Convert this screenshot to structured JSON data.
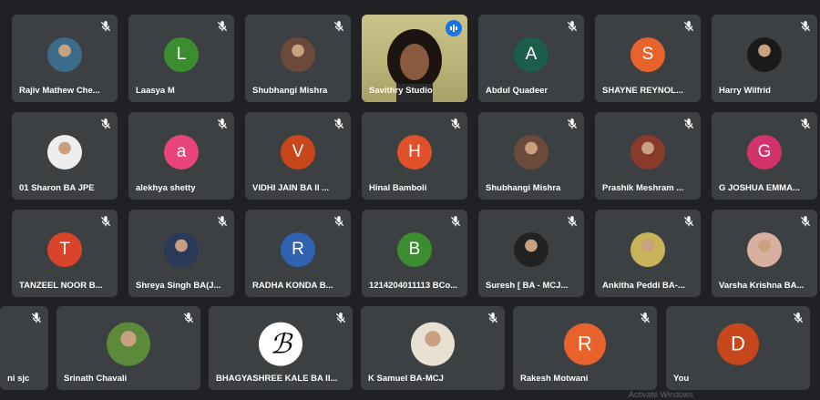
{
  "participants": {
    "row1": [
      {
        "name": "Rajiv Mathew Che...",
        "kind": "photo",
        "color": "#3d6b8a"
      },
      {
        "name": "Laasya M",
        "kind": "letter",
        "letter": "L",
        "color": "#3c8d2f"
      },
      {
        "name": "Shubhangi Mishra",
        "kind": "photo",
        "color": "#6b4a3a"
      },
      {
        "name": "Savithry Studio",
        "kind": "video",
        "color": "#b9b277"
      },
      {
        "name": "Abdul Quadeer",
        "kind": "letter",
        "letter": "A",
        "color": "#1b5e4b"
      },
      {
        "name": "SHAYNE REYNOL...",
        "kind": "letter",
        "letter": "S",
        "color": "#e8622c"
      },
      {
        "name": "Harry Wilfrid",
        "kind": "photo",
        "color": "#1a1a1a"
      }
    ],
    "row2": [
      {
        "name": "01 Sharon BA JPE",
        "kind": "photo",
        "color": "#eeeeee"
      },
      {
        "name": "alekhya shetty",
        "kind": "letter",
        "letter": "a",
        "color": "#e8457a"
      },
      {
        "name": "VIDHI JAIN BA II ...",
        "kind": "letter",
        "letter": "V",
        "color": "#c8461c"
      },
      {
        "name": "Hinal Bamboli",
        "kind": "letter",
        "letter": "H",
        "color": "#e0502a"
      },
      {
        "name": "Shubhangi Mishra",
        "kind": "photo",
        "color": "#6b4a3a"
      },
      {
        "name": "Prashik Meshram ...",
        "kind": "photo",
        "color": "#8a3a2a"
      },
      {
        "name": "G JOSHUA EMMA...",
        "kind": "letter",
        "letter": "G",
        "color": "#d3336b"
      }
    ],
    "row3": [
      {
        "name": "TANZEEL NOOR B...",
        "kind": "letter",
        "letter": "T",
        "color": "#d8442a"
      },
      {
        "name": "Shreya Singh BA(J...",
        "kind": "photo",
        "color": "#2a3a5a"
      },
      {
        "name": "RADHA KONDA B...",
        "kind": "letter",
        "letter": "R",
        "color": "#2f62b0"
      },
      {
        "name": "1214204011113 BCo...",
        "kind": "letter",
        "letter": "B",
        "color": "#3c8d2f"
      },
      {
        "name": "Suresh [ BA - MCJ...",
        "kind": "photo",
        "color": "#222222"
      },
      {
        "name": "Ankitha Peddi BA-...",
        "kind": "photo",
        "color": "#c8b25a"
      },
      {
        "name": "Varsha Krishna BA...",
        "kind": "photo",
        "color": "#d8b0a0"
      }
    ],
    "row4": [
      {
        "name": "ni sjc",
        "kind": "none",
        "color": "#3c4043"
      },
      {
        "name": "Srinath Chavali",
        "kind": "photo",
        "color": "#5a8a3a"
      },
      {
        "name": "BHAGYASHREE KALE BA II...",
        "kind": "logo",
        "color": "#ffffff"
      },
      {
        "name": "K Samuel BA-MCJ",
        "kind": "photo",
        "color": "#e8e0d0"
      },
      {
        "name": "Rakesh Motwani",
        "kind": "letter",
        "letter": "R",
        "color": "#e8622c"
      },
      {
        "name": "You",
        "kind": "letter",
        "letter": "D",
        "color": "#c8461c"
      }
    ]
  },
  "footer": {
    "watermark": "Activate Windows"
  },
  "colors": {
    "tile": "#3c4043",
    "background": "#202124",
    "active_outline": "#8ab4f8"
  }
}
